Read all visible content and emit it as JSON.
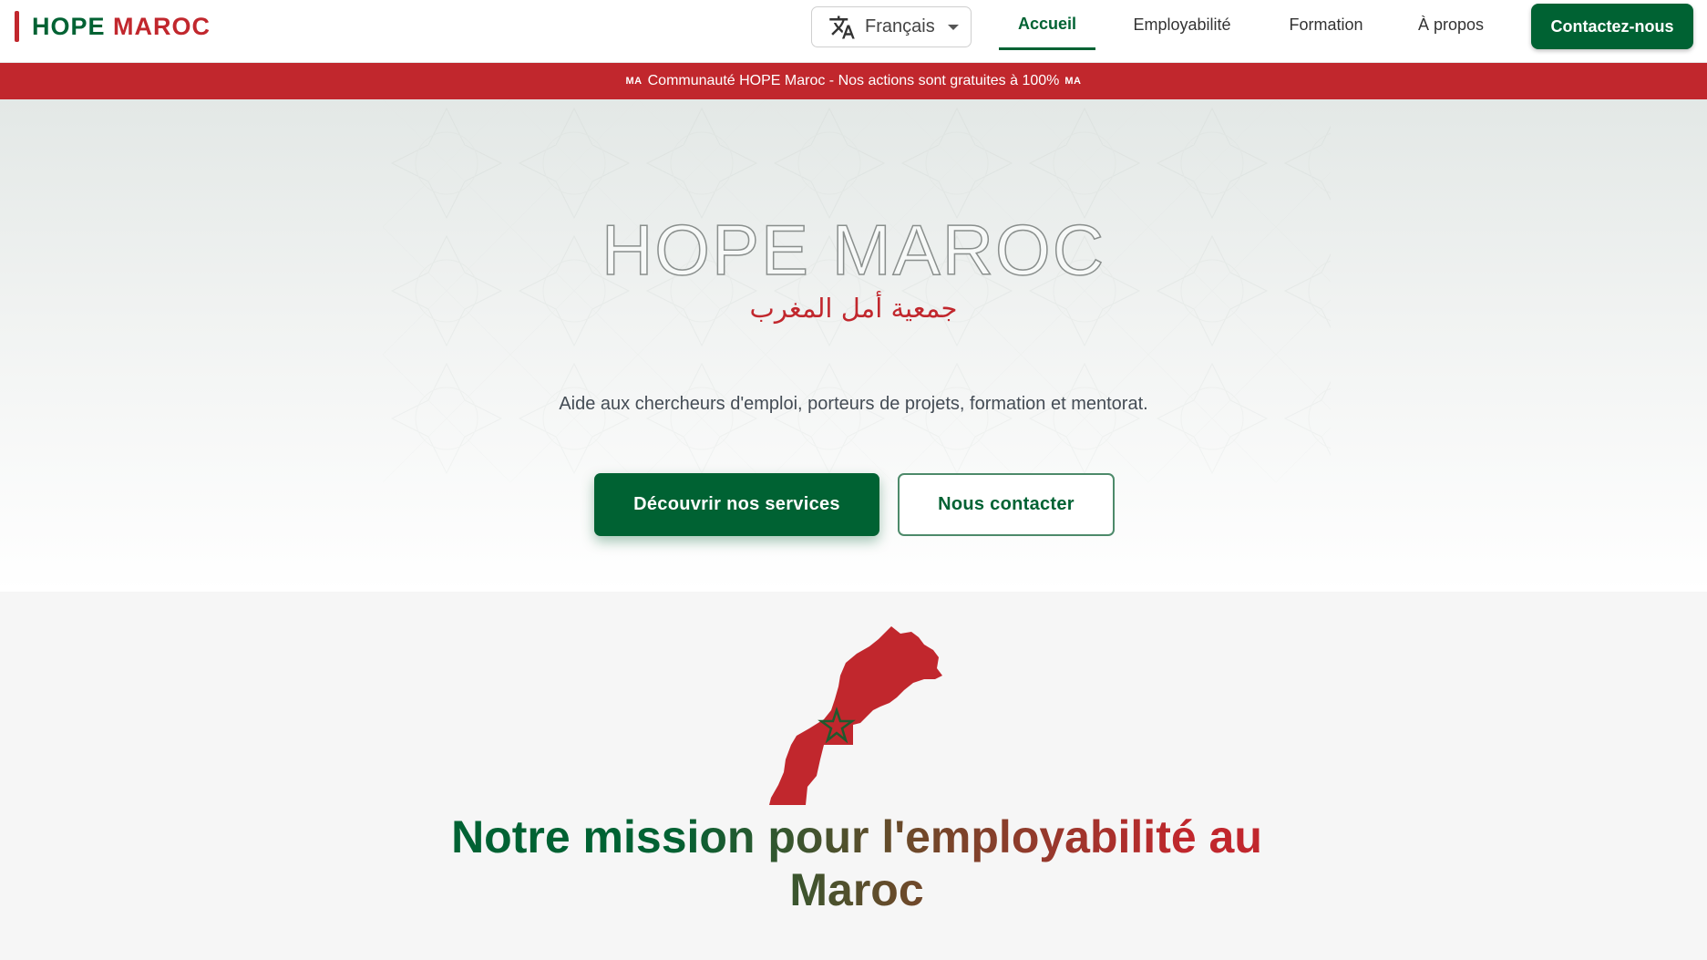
{
  "header": {
    "logo": {
      "part1": "HOPE",
      "part2": "MAROC"
    },
    "language": {
      "selected": "Français",
      "icon": "translate-icon"
    },
    "nav": [
      {
        "label": "Accueil",
        "active": true
      },
      {
        "label": "Employabilité",
        "active": false
      },
      {
        "label": "Formation",
        "active": false
      },
      {
        "label": "À propos",
        "active": false
      }
    ],
    "cta_label": "Contactez-nous"
  },
  "banner": {
    "flag_left": "MA",
    "text": "Communauté HOPE Maroc - Nos actions sont gratuites à 100%",
    "flag_right": "MA"
  },
  "hero": {
    "title": "HOPE MAROC",
    "arabic": "جمعية أمل المغرب",
    "subtitle": "Aide aux chercheurs d'emploi, porteurs de projets, formation et mentorat.",
    "primary_button": "Découvrir nos services",
    "secondary_button": "Nous contacter"
  },
  "mission": {
    "map_icon": "morocco-map-icon",
    "title": "Notre mission pour l'employabilité au Maroc"
  },
  "colors": {
    "green": "#006233",
    "red": "#c1272d"
  }
}
